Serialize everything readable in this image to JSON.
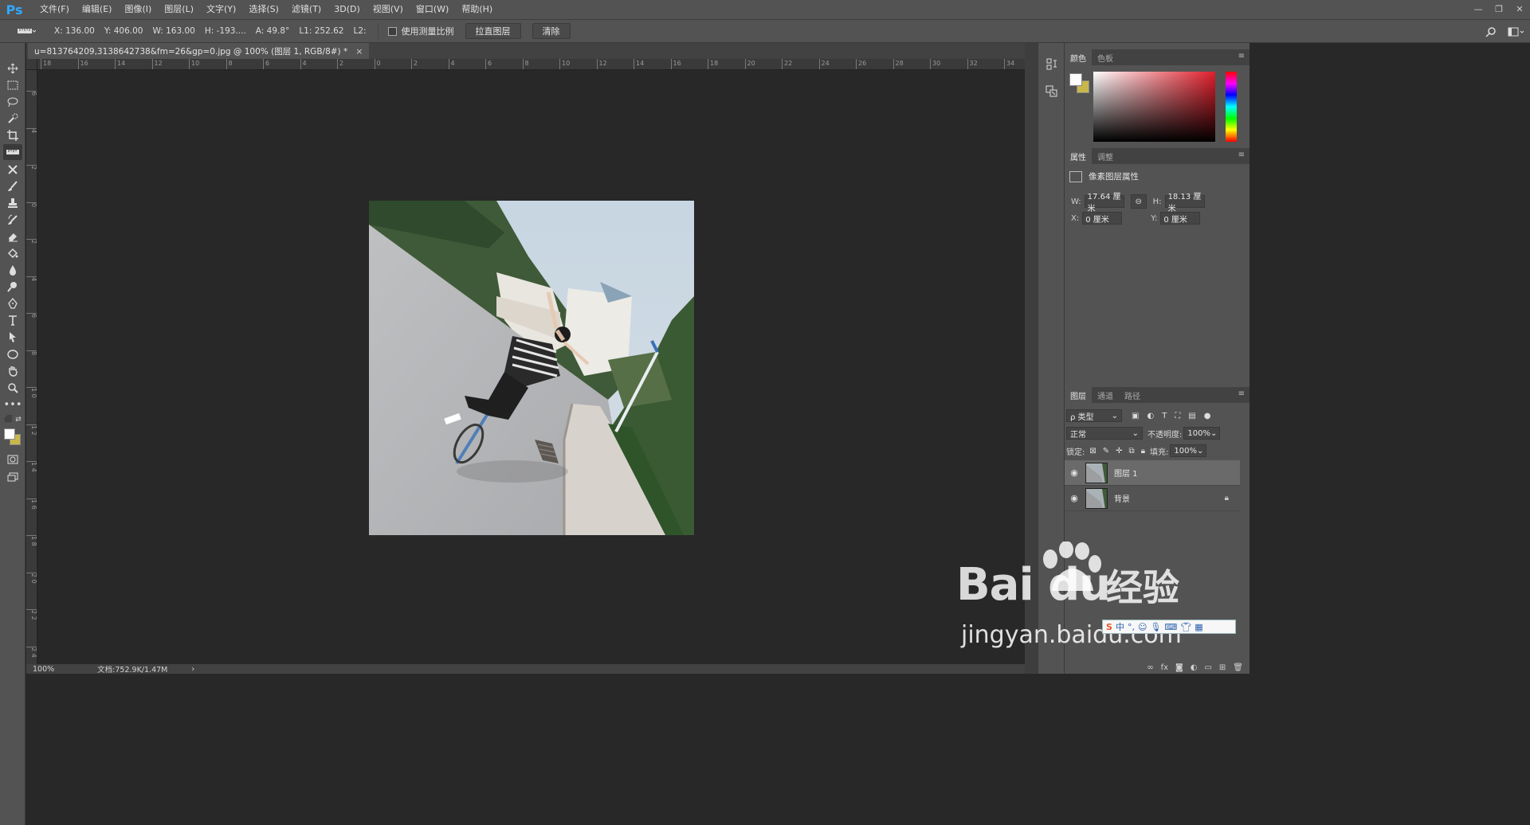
{
  "app": {
    "logo": "Ps"
  },
  "menu": [
    "文件(F)",
    "编辑(E)",
    "图像(I)",
    "图层(L)",
    "文字(Y)",
    "选择(S)",
    "滤镜(T)",
    "3D(D)",
    "视图(V)",
    "窗口(W)",
    "帮助(H)"
  ],
  "window_controls": [
    "—",
    "❐",
    "✕"
  ],
  "options": {
    "readouts": [
      "X: 136.00",
      "Y: 406.00",
      "W: 163.00",
      "H: -193....",
      "A: 49.8°",
      "L1: 252.62",
      "L2:"
    ],
    "checkbox_label": "使用测量比例",
    "straighten_button": "拉直图层",
    "clear_button": "清除"
  },
  "document": {
    "tab_title": "u=813764209,3138642738&fm=26&gp=0.jpg @ 100% (图层 1, RGB/8#) *",
    "close": "×"
  },
  "ruler_h_labels": [
    "18",
    "16",
    "14",
    "12",
    "10",
    "8",
    "6",
    "4",
    "2",
    "0",
    "2",
    "4",
    "6",
    "8",
    "10",
    "12",
    "14",
    "16",
    "18",
    "20",
    "22",
    "24",
    "26",
    "28",
    "30",
    "32",
    "34"
  ],
  "ruler_v_labels": [
    "6",
    "4",
    "2",
    "0",
    "2",
    "4",
    "6",
    "8",
    "1 0",
    "1 2",
    "1 4",
    "1 6",
    "1 8",
    "2 0",
    "2 2",
    "2 4"
  ],
  "status": {
    "zoom": "100%",
    "doc_size": "文档:752.9K/1.47M",
    "arrow": "›"
  },
  "color_panel": {
    "tabs": [
      "颜色",
      "色板"
    ],
    "foreground": "#ffffff",
    "background": "#c9b74b"
  },
  "properties_panel": {
    "tabs": [
      "属性",
      "调整"
    ],
    "header": "像素图层属性",
    "w_label": "W:",
    "w_value": "17.64 厘米",
    "h_label": "H:",
    "h_value": "18.13 厘米",
    "x_label": "X:",
    "x_value": "0 厘米",
    "y_label": "Y:",
    "y_value": "0 厘米"
  },
  "layers_panel": {
    "tabs": [
      "图层",
      "通道",
      "路径"
    ],
    "filter_kind": "ρ 类型",
    "blend_mode": "正常",
    "opacity_label": "不透明度:",
    "opacity_value": "100%",
    "lock_label": "锁定:",
    "fill_label": "填充:",
    "fill_value": "100%",
    "layers": [
      {
        "name": "图层 1",
        "selected": true,
        "locked": false
      },
      {
        "name": "背景",
        "selected": false,
        "locked": true
      }
    ],
    "footer_icons": [
      "link-icon",
      "fx-icon",
      "mask-icon",
      "adjustment-icon",
      "group-icon",
      "new-layer-icon",
      "trash-icon"
    ]
  },
  "watermark": {
    "brand": "Bai du",
    "brand_cn": "经验",
    "url": "jingyan.baidu.com"
  },
  "ime": {
    "label": "中"
  }
}
